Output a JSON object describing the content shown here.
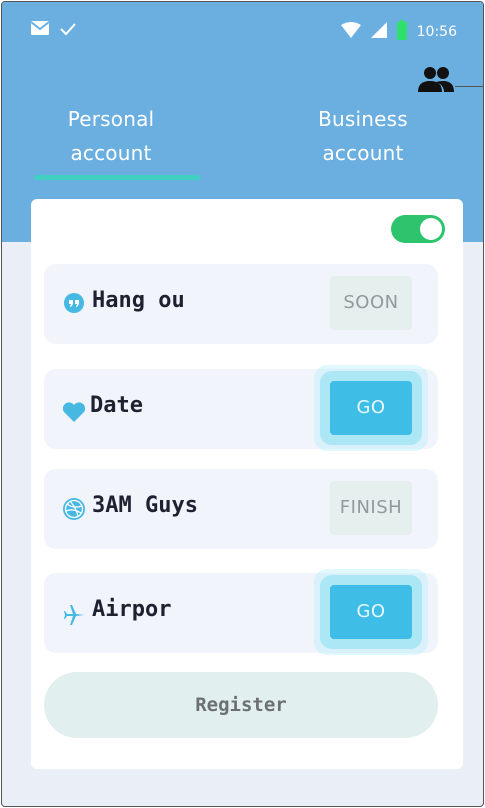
{
  "status_bar": {
    "time": "10:56",
    "left_icons": [
      "mail-icon",
      "check-icon"
    ],
    "right_icons": [
      "wifi-icon",
      "signal-icon",
      "battery-icon"
    ]
  },
  "header": {
    "action_icon": "people-icon",
    "tabs": [
      {
        "line1": "Personal",
        "line2": "account",
        "active": true
      },
      {
        "line1": "Business",
        "line2": "account",
        "active": false
      }
    ]
  },
  "toggle": {
    "on": true
  },
  "items": [
    {
      "icon": "hangouts-icon",
      "label": "Hang ou",
      "button": "SOON",
      "state": "disabled"
    },
    {
      "icon": "heart-icon",
      "label": "Date",
      "button": "GO",
      "state": "active"
    },
    {
      "icon": "dribbble-icon",
      "label": "3AM Guys",
      "button": "FINISH",
      "state": "disabled"
    },
    {
      "icon": "airplane-icon",
      "label": "Airpor",
      "button": "GO",
      "state": "active"
    }
  ],
  "register_label": "Register",
  "colors": {
    "header": "#6aafe0",
    "accent": "#3ebde6",
    "toggle": "#2ec46e",
    "tab_indicator": "#3fd0c0"
  }
}
